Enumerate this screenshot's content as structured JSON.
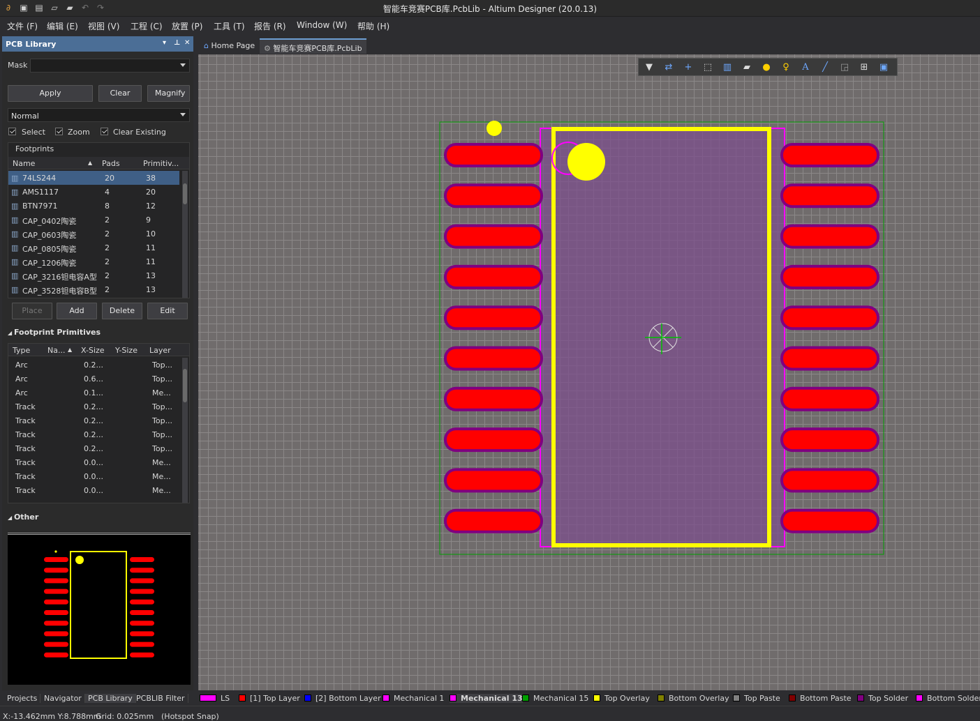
{
  "window": {
    "title": "智能车竞赛PCB库.PcbLib - Altium Designer (20.0.13)"
  },
  "menu": [
    "文件 (F)",
    "编辑 (E)",
    "视图 (V)",
    "工程 (C)",
    "放置 (P)",
    "工具 (T)",
    "报告 (R)",
    "Window (W)",
    "帮助 (H)"
  ],
  "panel": {
    "title": "PCB Library",
    "mask_label": "Mask",
    "mask_value": "",
    "apply": "Apply",
    "clear": "Clear",
    "magnify": "Magnify",
    "mode": "Normal",
    "select": "Select",
    "zoom": "Zoom",
    "clear_existing": "Clear Existing",
    "footprints_title": "Footprints",
    "fp_columns": [
      "Name",
      "Pads",
      "Primitiv..."
    ],
    "footprints": [
      {
        "name": "74LS244",
        "pads": "20",
        "prims": "38"
      },
      {
        "name": "AMS1117",
        "pads": "4",
        "prims": "20"
      },
      {
        "name": "BTN7971",
        "pads": "8",
        "prims": "12"
      },
      {
        "name": "CAP_0402陶瓷",
        "pads": "2",
        "prims": "9"
      },
      {
        "name": "CAP_0603陶瓷",
        "pads": "2",
        "prims": "10"
      },
      {
        "name": "CAP_0805陶瓷",
        "pads": "2",
        "prims": "11"
      },
      {
        "name": "CAP_1206陶瓷",
        "pads": "2",
        "prims": "11"
      },
      {
        "name": "CAP_3216钽电容A型",
        "pads": "2",
        "prims": "13"
      },
      {
        "name": "CAP_3528钽电容B型",
        "pads": "2",
        "prims": "13"
      }
    ],
    "place": "Place",
    "add": "Add",
    "delete": "Delete",
    "edit": "Edit",
    "primitives_title": "Footprint Primitives",
    "prim_columns": [
      "Type",
      "Na...",
      "X-Size",
      "Y-Size",
      "Layer"
    ],
    "primitives": [
      {
        "type": "Arc",
        "x": "0.2...",
        "layer": "Top..."
      },
      {
        "type": "Arc",
        "x": "0.6...",
        "layer": "Top..."
      },
      {
        "type": "Arc",
        "x": "0.1...",
        "layer": "Me..."
      },
      {
        "type": "Track",
        "x": "0.2...",
        "layer": "Top..."
      },
      {
        "type": "Track",
        "x": "0.2...",
        "layer": "Top..."
      },
      {
        "type": "Track",
        "x": "0.2...",
        "layer": "Top..."
      },
      {
        "type": "Track",
        "x": "0.2...",
        "layer": "Top..."
      },
      {
        "type": "Track",
        "x": "0.0...",
        "layer": "Me..."
      },
      {
        "type": "Track",
        "x": "0.0...",
        "layer": "Me..."
      },
      {
        "type": "Track",
        "x": "0.0...",
        "layer": "Me..."
      }
    ],
    "other_title": "Other"
  },
  "panel_tabs": [
    "Projects",
    "Navigator",
    "PCB Library",
    "PCBLIB Filter"
  ],
  "doc_tabs": [
    {
      "label": "Home Page"
    },
    {
      "label": "智能车竞赛PCB库.PcbLib"
    }
  ],
  "layers": [
    {
      "label": "LS",
      "color": "#ff00ff"
    },
    {
      "label": "[1] Top Layer",
      "color": "#ff0000"
    },
    {
      "label": "[2] Bottom Layer",
      "color": "#0000ff"
    },
    {
      "label": "Mechanical 1",
      "color": "#ff00ff"
    },
    {
      "label": "Mechanical 13",
      "color": "#ff00ff"
    },
    {
      "label": "Mechanical 15",
      "color": "#00a000"
    },
    {
      "label": "Top Overlay",
      "color": "#ffff00"
    },
    {
      "label": "Bottom Overlay",
      "color": "#808000"
    },
    {
      "label": "Top Paste",
      "color": "#808080"
    },
    {
      "label": "Bottom Paste",
      "color": "#800000"
    },
    {
      "label": "Top Solder",
      "color": "#800080"
    },
    {
      "label": "Bottom Solder",
      "color": "#ff00ff"
    }
  ],
  "status": {
    "coords": "X:-13.462mm Y:8.788mm",
    "grid": "Grid: 0.025mm",
    "snap": "(Hotspot Snap)"
  },
  "colors": {
    "pad": "#ff0000",
    "solder_mask": "#800080",
    "overlay": "#ffff00",
    "mech13": "#ff00ff",
    "courtyard": "#00a000"
  }
}
